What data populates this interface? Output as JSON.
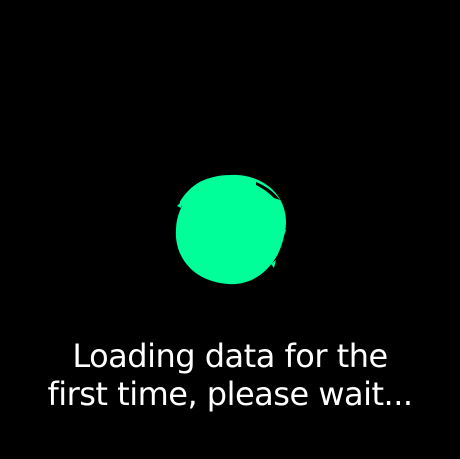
{
  "loading": {
    "line1": "Loading data for the",
    "line2": "first time, please wait..."
  },
  "spinner": {
    "icon": "loading-blob-icon",
    "color": "#00ff99"
  },
  "colors": {
    "background": "#000000",
    "text": "#ffffff"
  }
}
